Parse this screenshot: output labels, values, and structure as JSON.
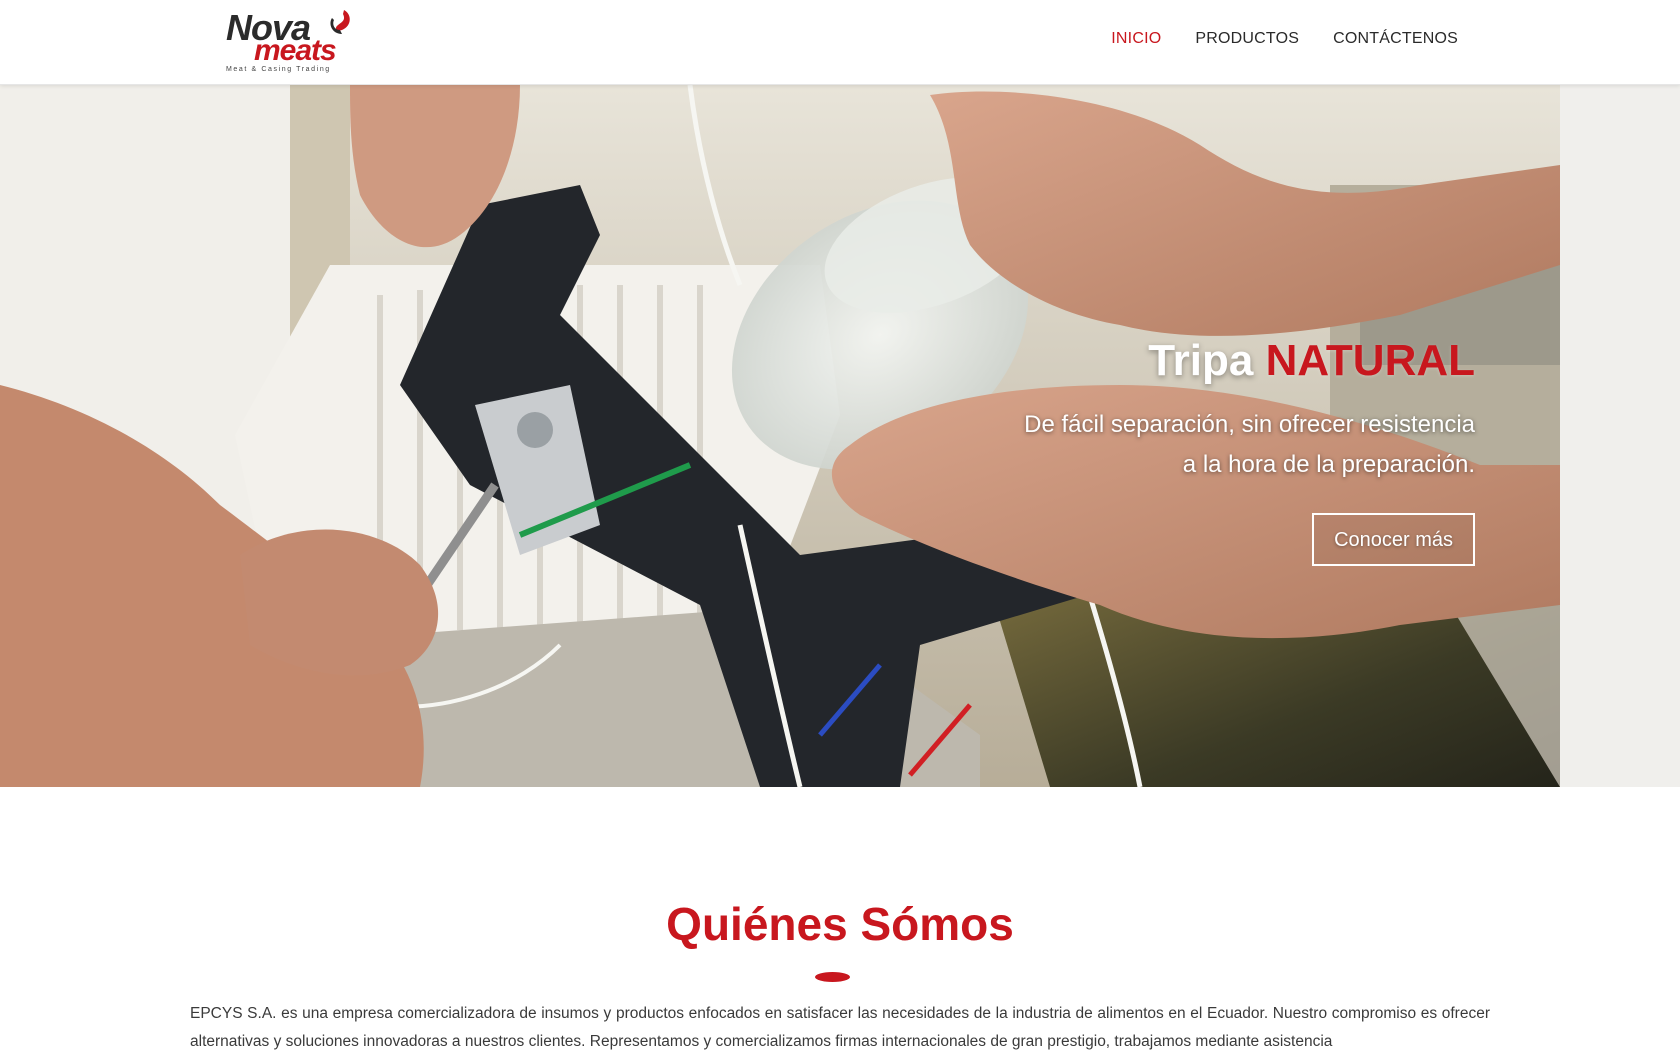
{
  "brand": {
    "name_top": "Nova",
    "name_bottom": "meats",
    "tagline": "Meat & Casing Trading"
  },
  "nav": {
    "items": [
      {
        "label": "INICIO",
        "active": true
      },
      {
        "label": "PRODUCTOS",
        "active": false
      },
      {
        "label": "CONTÁCTENOS",
        "active": false
      }
    ]
  },
  "hero": {
    "title_main": "Tripa",
    "title_accent": "NATURAL",
    "subtitle_line1": "De fácil separación, sin ofrecer resistencia",
    "subtitle_line2": "a la hora de la preparación.",
    "button_label": "Conocer más"
  },
  "about": {
    "title": "Quiénes Sómos",
    "body": "EPCYS S.A. es una empresa comercializadora de insumos y productos enfocados en satisfacer las necesidades de la industria de alimentos en el Ecuador. Nuestro compromiso es ofrecer alternativas y soluciones innovadoras a nuestros clientes. Representamos y comercializamos firmas internacionales de gran prestigio, trabajamos mediante asistencia"
  },
  "colors": {
    "accent": "#c8171e",
    "nav_text": "#2a2a2a"
  }
}
